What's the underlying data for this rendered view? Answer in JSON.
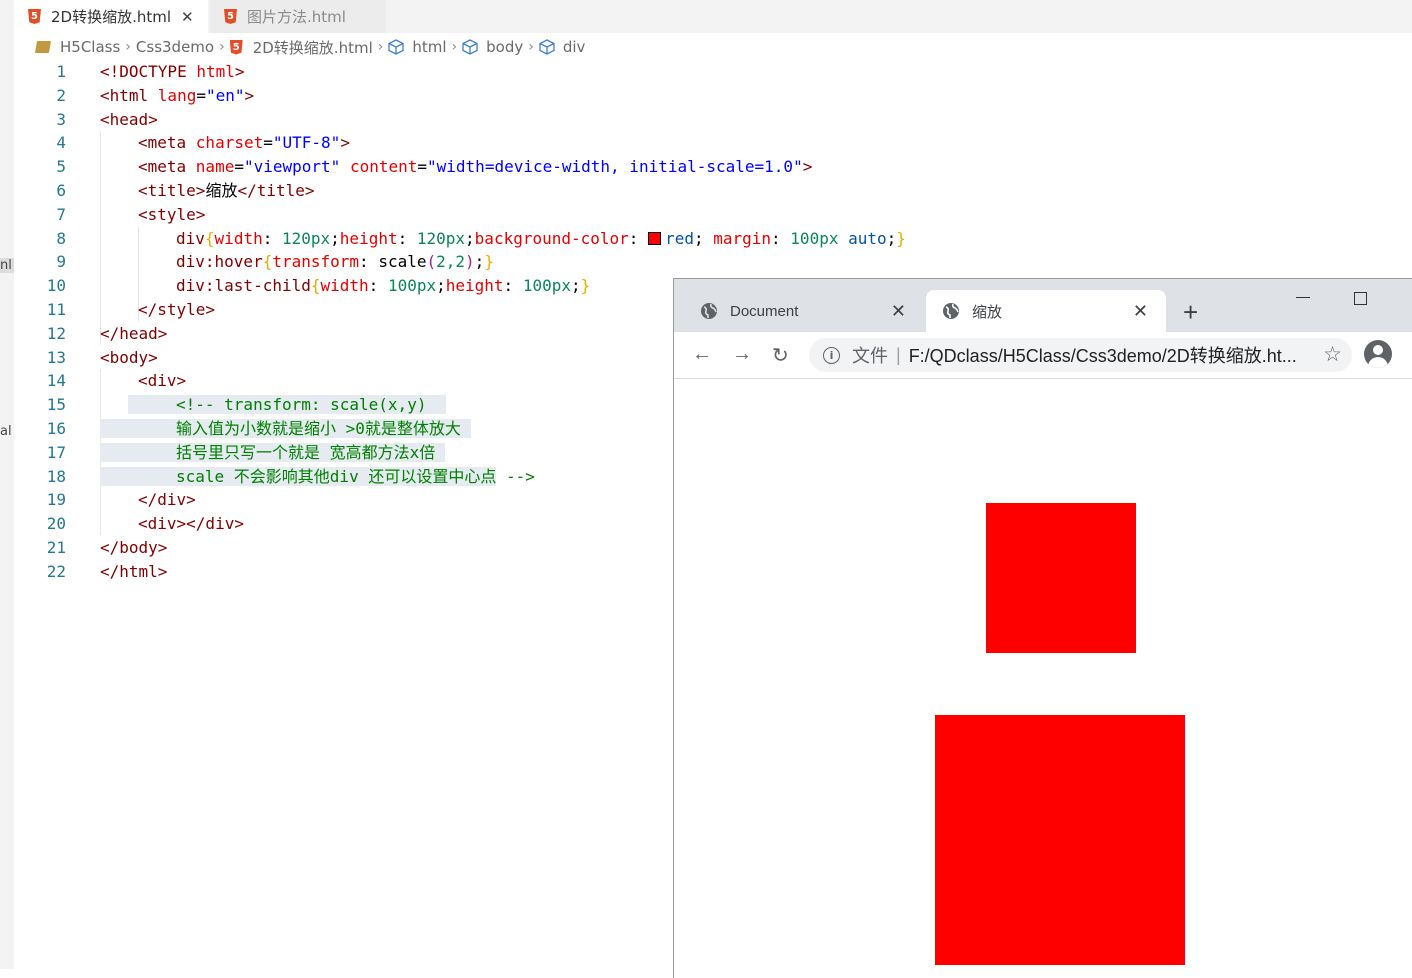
{
  "editor": {
    "tabs": [
      {
        "label": "2D转换缩放.html",
        "active": true
      },
      {
        "label": "图片方法.html",
        "active": false
      }
    ],
    "breadcrumb": [
      "H5Class",
      "Css3demo",
      "2D转换缩放.html",
      "html",
      "body",
      "div"
    ],
    "line_numbers": [
      "1",
      "2",
      "3",
      "4",
      "5",
      "6",
      "7",
      "8",
      "9",
      "10",
      "11",
      "12",
      "13",
      "14",
      "15",
      "16",
      "17",
      "18",
      "19",
      "20",
      "21",
      "22"
    ],
    "left_strip_fragments": [
      "nl",
      "al"
    ],
    "code": {
      "l1": [
        "<!DOCTYPE ",
        "html",
        ">"
      ],
      "l2": [
        "<html ",
        "lang",
        "=",
        "\"en\"",
        ">"
      ],
      "l3": "<head>",
      "l4": [
        "<meta ",
        "charset",
        "=",
        "\"UTF-8\"",
        ">"
      ],
      "l5": [
        "<meta ",
        "name",
        "=",
        "\"viewport\"",
        " ",
        "content",
        "=",
        "\"width=device-width, initial-scale=1.0\"",
        ">"
      ],
      "l6": [
        "<title>",
        "缩放",
        "</title>"
      ],
      "l7": "<style>",
      "l8": [
        "div",
        "{",
        "width",
        ": ",
        "120px",
        ";",
        "height",
        ": ",
        "120px",
        ";",
        "background-color",
        ": ",
        "red",
        "; ",
        "margin",
        ": ",
        "100px",
        " auto",
        ";",
        "}"
      ],
      "l9": [
        "div:hover",
        "{",
        "transform",
        ": scale",
        "(",
        "2,2",
        ")",
        ";",
        "}"
      ],
      "l10": [
        "div:last-child",
        "{",
        "width",
        ": ",
        "100px",
        ";",
        "height",
        ": ",
        "100px",
        ";",
        "}"
      ],
      "l11": "</style>",
      "l12": "</head>",
      "l13": "<body>",
      "l14": "<div>",
      "l15": "<!-- transform: scale(x,y)",
      "l16": "输入值为小数就是缩小 >0就是整体放大",
      "l17": "括号里只写一个就是 宽高都方法x倍",
      "l18a": "scale 不会影响其他div 还可以设置中心点",
      "l18b": " -->",
      "l19": "</div>",
      "l20": "<div></div>",
      "l21": "</body>",
      "l22": "</html>"
    }
  },
  "browser": {
    "tabs": [
      {
        "label": "Document",
        "active": false
      },
      {
        "label": "缩放",
        "active": true
      }
    ],
    "new_tab": "+",
    "omnibox": {
      "label": "文件",
      "divider": "|",
      "url": "F:/QDclass/H5Class/Css3demo/2D转换缩放.ht..."
    },
    "colors": {
      "box": "#ff0000"
    }
  }
}
